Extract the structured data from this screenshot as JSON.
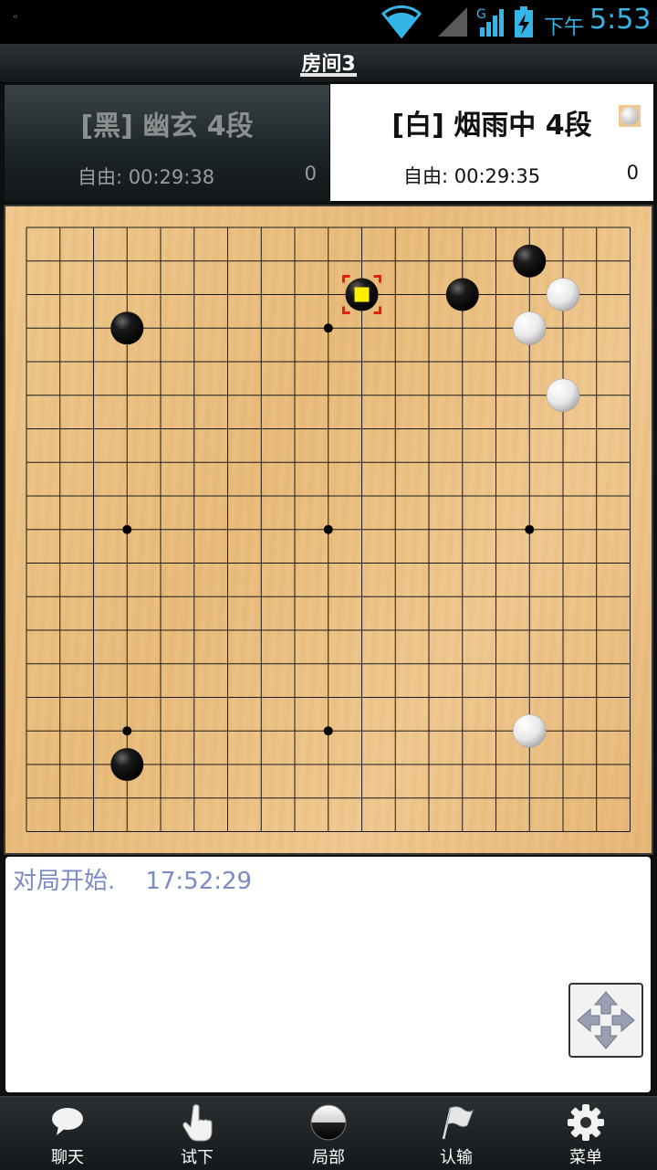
{
  "status_bar": {
    "network_label": "G",
    "ampm": "下午",
    "time": "5:53"
  },
  "header": {
    "room_title": "房间3"
  },
  "players": {
    "black": {
      "name": "[黑] 幽玄 4段",
      "time": "自由: 00:29:38",
      "captures": "0"
    },
    "white": {
      "name": "[白] 烟雨中 4段",
      "time": "自由: 00:29:35",
      "captures": "0"
    },
    "turn": "white"
  },
  "board": {
    "size": 19,
    "hoshi": [
      [
        3,
        3
      ],
      [
        9,
        3
      ],
      [
        15,
        3
      ],
      [
        3,
        9
      ],
      [
        9,
        9
      ],
      [
        15,
        9
      ],
      [
        3,
        15
      ],
      [
        9,
        15
      ],
      [
        15,
        15
      ]
    ],
    "stones": [
      {
        "color": "black",
        "col": 15,
        "row": 1
      },
      {
        "color": "black",
        "col": 10,
        "row": 2,
        "last_move": true
      },
      {
        "color": "black",
        "col": 13,
        "row": 2
      },
      {
        "color": "white",
        "col": 16,
        "row": 2
      },
      {
        "color": "black",
        "col": 3,
        "row": 3
      },
      {
        "color": "white",
        "col": 15,
        "row": 3
      },
      {
        "color": "white",
        "col": 16,
        "row": 5
      },
      {
        "color": "white",
        "col": 15,
        "row": 15
      },
      {
        "color": "black",
        "col": 3,
        "row": 16
      }
    ]
  },
  "log": {
    "lines": [
      "对局开始.    17:52:29"
    ]
  },
  "bottom_bar": {
    "items": [
      {
        "label": "聊天",
        "icon": "chat-bubble-icon"
      },
      {
        "label": "试下",
        "icon": "hand-pointer-icon"
      },
      {
        "label": "局部",
        "icon": "half-stone-icon"
      },
      {
        "label": "认输",
        "icon": "white-flag-icon"
      },
      {
        "label": "菜单",
        "icon": "gear-icon"
      }
    ]
  }
}
